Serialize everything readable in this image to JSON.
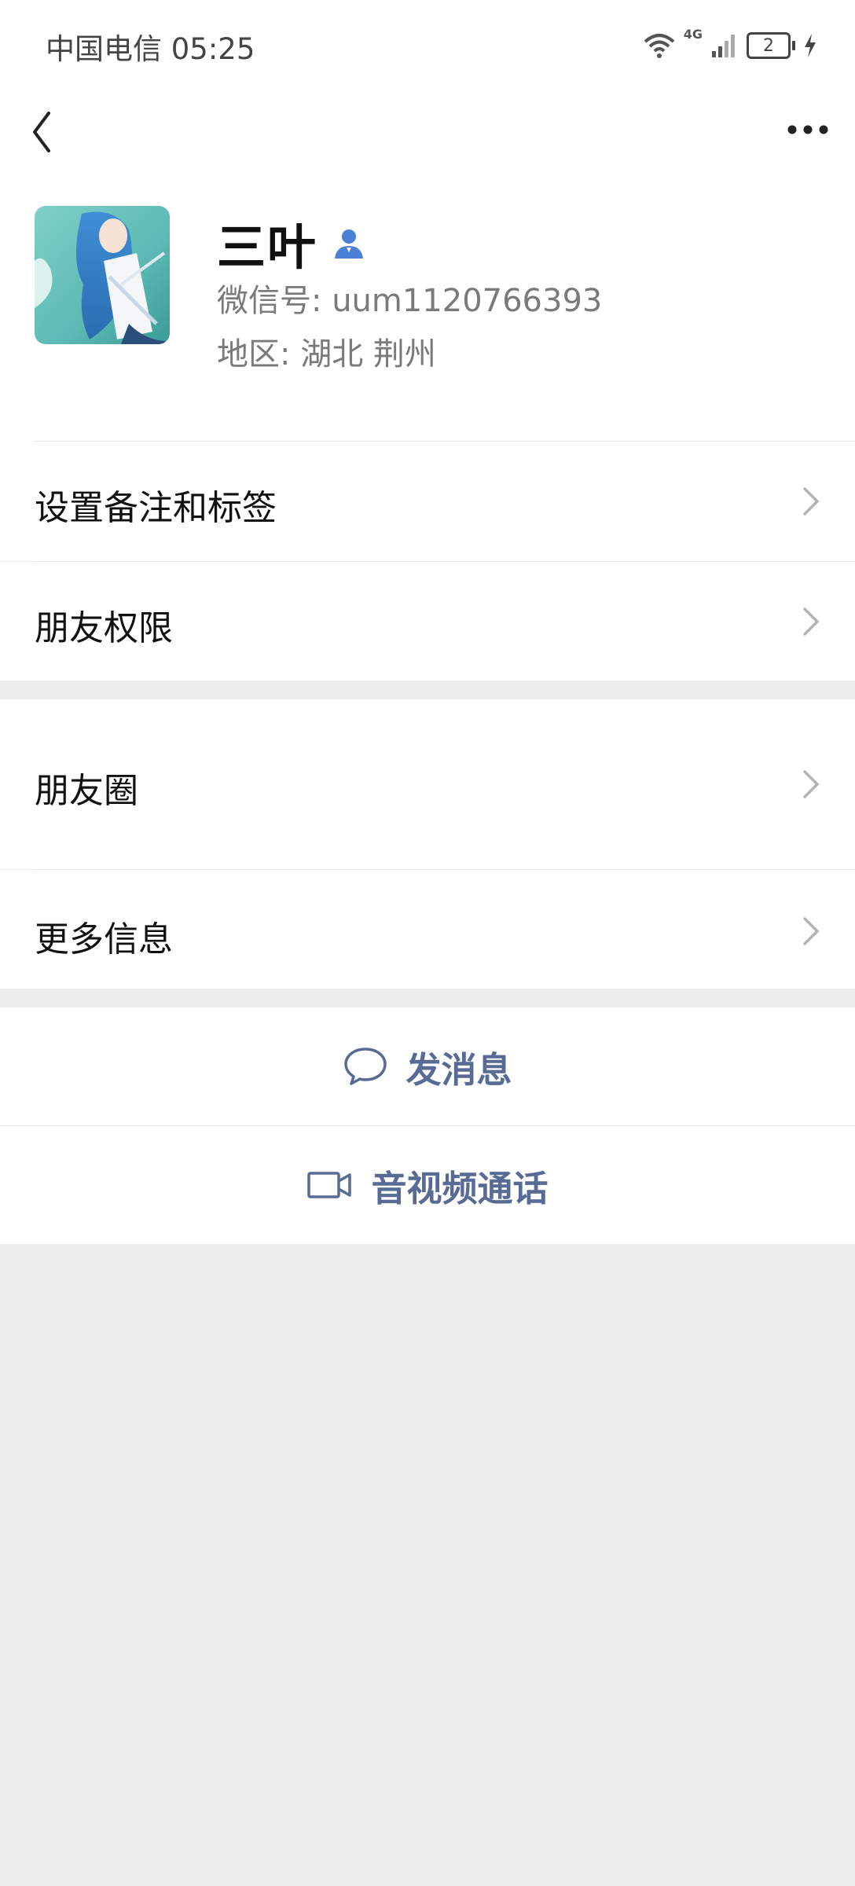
{
  "status_bar": {
    "carrier_time": "中国电信 05:25",
    "network": "4G",
    "battery": "2"
  },
  "header": {
    "back_icon": "chevron-left-icon",
    "more_icon": "more-dots-icon"
  },
  "profile": {
    "name": "三叶",
    "wechat_id": "微信号: uum1120766393",
    "region": "地区: 湖北  荆州"
  },
  "menu": {
    "remark_tags": "设置备注和标签",
    "permissions": "朋友权限",
    "moments": "朋友圈",
    "more_info": "更多信息"
  },
  "actions": {
    "message": "发消息",
    "av_call": "音视频通话"
  },
  "colors": {
    "accent": "#576b95",
    "background": "#ededed",
    "user_badge": "#4a7fd6"
  }
}
